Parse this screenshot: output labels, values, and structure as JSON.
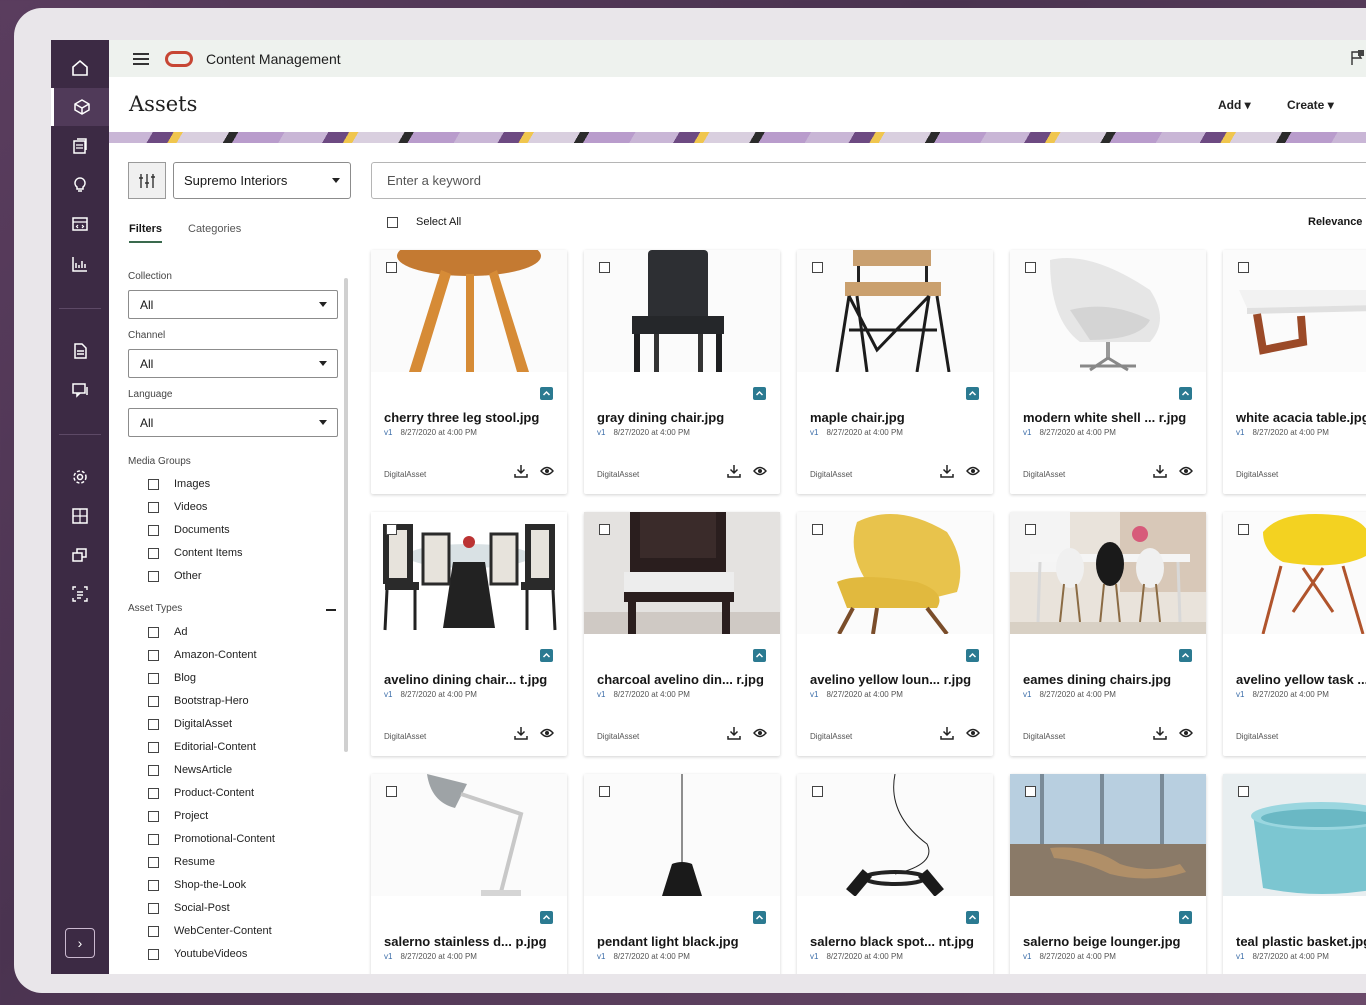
{
  "app": {
    "title": "Content Management",
    "page_title": "Assets",
    "add_label": "Add",
    "create_label": "Create"
  },
  "filters": {
    "repository": "Supremo Interiors",
    "search_placeholder": "Enter a keyword",
    "tabs": [
      "Filters",
      "Categories"
    ],
    "collection_label": "Collection",
    "collection_value": "All",
    "channel_label": "Channel",
    "channel_value": "All",
    "language_label": "Language",
    "language_value": "All",
    "media_groups_label": "Media Groups",
    "media_groups": [
      "Images",
      "Videos",
      "Documents",
      "Content Items",
      "Other"
    ],
    "asset_types_label": "Asset Types",
    "asset_types": [
      "Ad",
      "Amazon-Content",
      "Blog",
      "Bootstrap-Hero",
      "DigitalAsset",
      "Editorial-Content",
      "NewsArticle",
      "Product-Content",
      "Project",
      "Promotional-Content",
      "Resume",
      "Shop-the-Look",
      "Social-Post",
      "WebCenter-Content",
      "YoutubeVideos"
    ]
  },
  "results": {
    "select_all_label": "Select All",
    "sort_label": "Relevance",
    "cards": [
      {
        "name": "cherry three leg stool.jpg",
        "version": "v1",
        "date": "8/27/2020 at 4:00 PM",
        "type": "DigitalAsset",
        "image": "stool"
      },
      {
        "name": "gray dining chair.jpg",
        "version": "v1",
        "date": "8/27/2020 at 4:00 PM",
        "type": "DigitalAsset",
        "image": "gray-chair"
      },
      {
        "name": "maple chair.jpg",
        "version": "v1",
        "date": "8/27/2020 at 4:00 PM",
        "type": "DigitalAsset",
        "image": "maple-chair"
      },
      {
        "name": "modern white shell ... r.jpg",
        "version": "v1",
        "date": "8/27/2020 at 4:00 PM",
        "type": "DigitalAsset",
        "image": "shell-chair"
      },
      {
        "name": "white acacia table.jpg",
        "version": "v1",
        "date": "8/27/2020 at 4:00 PM",
        "type": "DigitalAsset",
        "image": "acacia-table"
      },
      {
        "name": "avelino dining chair... t.jpg",
        "version": "v1",
        "date": "8/27/2020 at 4:00 PM",
        "type": "DigitalAsset",
        "image": "dining-set"
      },
      {
        "name": "charcoal avelino din... r.jpg",
        "version": "v1",
        "date": "8/27/2020 at 4:00 PM",
        "type": "DigitalAsset",
        "image": "charcoal-chair"
      },
      {
        "name": "avelino yellow loun... r.jpg",
        "version": "v1",
        "date": "8/27/2020 at 4:00 PM",
        "type": "DigitalAsset",
        "image": "yellow-lounge"
      },
      {
        "name": "eames dining chairs.jpg",
        "version": "v1",
        "date": "8/27/2020 at 4:00 PM",
        "type": "DigitalAsset",
        "image": "eames-room"
      },
      {
        "name": "avelino yellow task ...",
        "version": "v1",
        "date": "8/27/2020 at 4:00 PM",
        "type": "DigitalAsset",
        "image": "yellow-task"
      },
      {
        "name": "salerno stainless d... p.jpg",
        "version": "v1",
        "date": "8/27/2020 at 4:00 PM",
        "type": "",
        "image": "desk-lamp"
      },
      {
        "name": "pendant light black.jpg",
        "version": "v1",
        "date": "8/27/2020 at 4:00 PM",
        "type": "",
        "image": "pendant"
      },
      {
        "name": "salerno black spot... nt.jpg",
        "version": "v1",
        "date": "8/27/2020 at 4:00 PM",
        "type": "",
        "image": "spot-light"
      },
      {
        "name": "salerno beige lounger.jpg",
        "version": "v1",
        "date": "8/27/2020 at 4:00 PM",
        "type": "",
        "image": "lounger"
      },
      {
        "name": "teal plastic basket.jpg",
        "version": "v1",
        "date": "8/27/2020 at 4:00 PM",
        "type": "",
        "image": "teal-basket"
      }
    ]
  },
  "colors": {
    "rail_bg": "#3c2a44",
    "accent_teal": "#2b7a91",
    "oracle_red": "#c74634"
  }
}
